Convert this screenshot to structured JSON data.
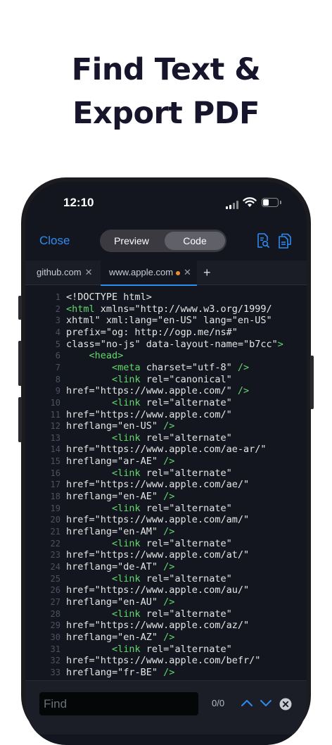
{
  "headline": {
    "line1": "Find Text &",
    "line2": "Export PDF"
  },
  "status_bar": {
    "time": "12:10"
  },
  "toolbar": {
    "close_label": "Close",
    "segments": [
      {
        "label": "Preview",
        "selected": false
      },
      {
        "label": "Code",
        "selected": true
      }
    ],
    "icons": [
      "search-document-icon",
      "copy-icon"
    ]
  },
  "tabs": [
    {
      "label": "github.com",
      "active": false
    },
    {
      "label": "www.apple.com",
      "active": true,
      "modified": true
    }
  ],
  "code_lines": [
    [
      {
        "t": "txt",
        "v": "<!DOCTYPE html>"
      }
    ],
    [
      {
        "t": "tag",
        "v": "<html"
      },
      {
        "t": "txt",
        "v": " xmlns=\"http://www.w3.org/1999/"
      }
    ],
    [
      {
        "t": "txt",
        "v": "xhtml\" xml:lang=\"en-US\" lang=\"en-US\""
      }
    ],
    [
      {
        "t": "txt",
        "v": "prefix=\"og: http://ogp.me/ns#\""
      }
    ],
    [
      {
        "t": "txt",
        "v": "class=\"no-js\" data-layout-name=\"b7cc\""
      },
      {
        "t": "tag",
        "v": ">"
      }
    ],
    [
      {
        "t": "txt",
        "v": "    "
      },
      {
        "t": "tag",
        "v": "<head>"
      }
    ],
    [
      {
        "t": "txt",
        "v": "        "
      },
      {
        "t": "tag",
        "v": "<meta"
      },
      {
        "t": "txt",
        "v": " charset=\"utf-8\" "
      },
      {
        "t": "tag",
        "v": "/>"
      }
    ],
    [
      {
        "t": "txt",
        "v": "        "
      },
      {
        "t": "tag",
        "v": "<link"
      },
      {
        "t": "txt",
        "v": " rel=\"canonical\""
      }
    ],
    [
      {
        "t": "txt",
        "v": "href=\"https://www.apple.com/\" "
      },
      {
        "t": "tag",
        "v": "/>"
      }
    ],
    [
      {
        "t": "txt",
        "v": "        "
      },
      {
        "t": "tag",
        "v": "<link"
      },
      {
        "t": "txt",
        "v": " rel=\"alternate\""
      }
    ],
    [
      {
        "t": "txt",
        "v": "href=\"https://www.apple.com/\""
      }
    ],
    [
      {
        "t": "txt",
        "v": "hreflang=\"en-US\" "
      },
      {
        "t": "tag",
        "v": "/>"
      }
    ],
    [
      {
        "t": "txt",
        "v": "        "
      },
      {
        "t": "tag",
        "v": "<link"
      },
      {
        "t": "txt",
        "v": " rel=\"alternate\""
      }
    ],
    [
      {
        "t": "txt",
        "v": "href=\"https://www.apple.com/ae-ar/\""
      }
    ],
    [
      {
        "t": "txt",
        "v": "hreflang=\"ar-AE\" "
      },
      {
        "t": "tag",
        "v": "/>"
      }
    ],
    [
      {
        "t": "txt",
        "v": "        "
      },
      {
        "t": "tag",
        "v": "<link"
      },
      {
        "t": "txt",
        "v": " rel=\"alternate\""
      }
    ],
    [
      {
        "t": "txt",
        "v": "href=\"https://www.apple.com/ae/\""
      }
    ],
    [
      {
        "t": "txt",
        "v": "hreflang=\"en-AE\" "
      },
      {
        "t": "tag",
        "v": "/>"
      }
    ],
    [
      {
        "t": "txt",
        "v": "        "
      },
      {
        "t": "tag",
        "v": "<link"
      },
      {
        "t": "txt",
        "v": " rel=\"alternate\""
      }
    ],
    [
      {
        "t": "txt",
        "v": "href=\"https://www.apple.com/am/\""
      }
    ],
    [
      {
        "t": "txt",
        "v": "hreflang=\"en-AM\" "
      },
      {
        "t": "tag",
        "v": "/>"
      }
    ],
    [
      {
        "t": "txt",
        "v": "        "
      },
      {
        "t": "tag",
        "v": "<link"
      },
      {
        "t": "txt",
        "v": " rel=\"alternate\""
      }
    ],
    [
      {
        "t": "txt",
        "v": "href=\"https://www.apple.com/at/\""
      }
    ],
    [
      {
        "t": "txt",
        "v": "hreflang=\"de-AT\" "
      },
      {
        "t": "tag",
        "v": "/>"
      }
    ],
    [
      {
        "t": "txt",
        "v": "        "
      },
      {
        "t": "tag",
        "v": "<link"
      },
      {
        "t": "txt",
        "v": " rel=\"alternate\""
      }
    ],
    [
      {
        "t": "txt",
        "v": "href=\"https://www.apple.com/au/\""
      }
    ],
    [
      {
        "t": "txt",
        "v": "hreflang=\"en-AU\" "
      },
      {
        "t": "tag",
        "v": "/>"
      }
    ],
    [
      {
        "t": "txt",
        "v": "        "
      },
      {
        "t": "tag",
        "v": "<link"
      },
      {
        "t": "txt",
        "v": " rel=\"alternate\""
      }
    ],
    [
      {
        "t": "txt",
        "v": "href=\"https://www.apple.com/az/\""
      }
    ],
    [
      {
        "t": "txt",
        "v": "hreflang=\"en-AZ\" "
      },
      {
        "t": "tag",
        "v": "/>"
      }
    ],
    [
      {
        "t": "txt",
        "v": "        "
      },
      {
        "t": "tag",
        "v": "<link"
      },
      {
        "t": "txt",
        "v": " rel=\"alternate\""
      }
    ],
    [
      {
        "t": "txt",
        "v": "href=\"https://www.apple.com/befr/\""
      }
    ],
    [
      {
        "t": "txt",
        "v": "hreflang=\"fr-BE\" "
      },
      {
        "t": "tag",
        "v": "/>"
      }
    ]
  ],
  "find_bar": {
    "placeholder": "Find",
    "match_count": "0/0",
    "icons": [
      "chevron-up-icon",
      "chevron-down-icon",
      "clear-icon"
    ]
  },
  "colors": {
    "accent": "#2e8bf0",
    "tag": "#62d96b",
    "modified_dot": "#f08c2e",
    "headline": "#17152b",
    "editor_background": "#13161f"
  }
}
